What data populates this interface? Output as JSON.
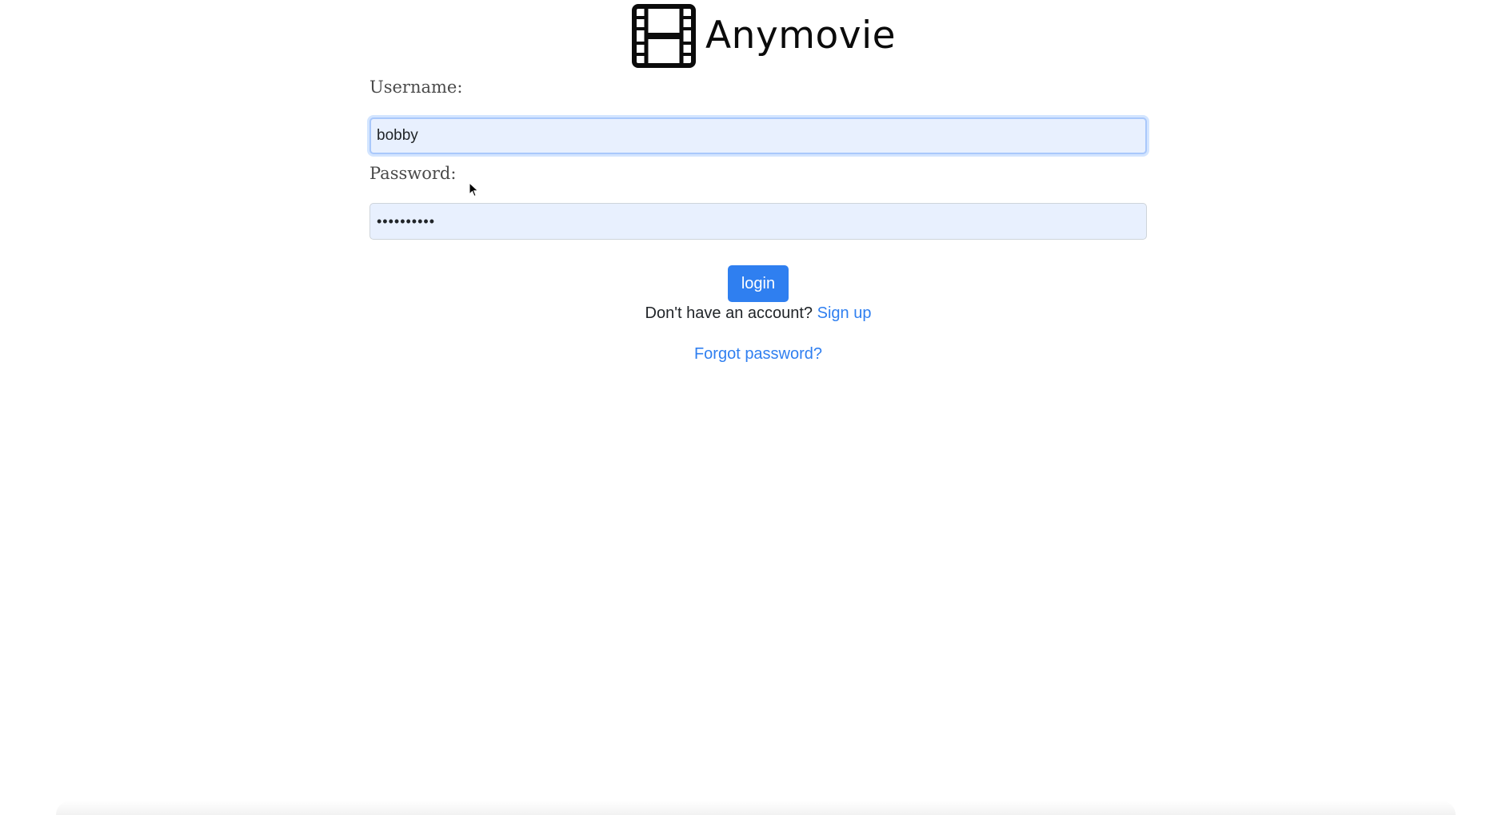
{
  "brand": {
    "name": "Anymovie",
    "icon": "film-strip-icon"
  },
  "form": {
    "username_label": "Username:",
    "username_value": "bobby",
    "password_label": "Password:",
    "password_value": "••••••••••"
  },
  "actions": {
    "login_label": "login",
    "signup_prompt": "Don't have an account?",
    "signup_link": "Sign up",
    "forgot_link": "Forgot password?"
  },
  "colors": {
    "accent": "#2f7ff0",
    "input_bg": "#e8f0fe"
  }
}
